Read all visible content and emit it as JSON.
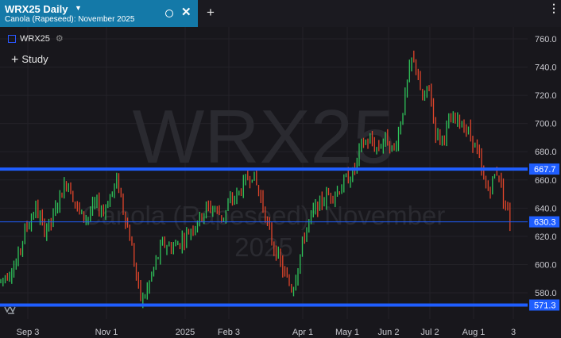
{
  "tab": {
    "title": "WRX25 Daily",
    "subtitle": "Canola (Rapeseed): November 2025",
    "caret_icon": "caret-down-icon",
    "circle_icon": "circle-icon",
    "close_icon": "close-icon"
  },
  "toolbar": {
    "new_tab": "+",
    "menu": "⋮"
  },
  "legend": {
    "symbol": "WRX25",
    "swatch_color": "#2a56ff"
  },
  "study": {
    "icon": "+",
    "label": "Study"
  },
  "watermark": {
    "symbol": "WRX25",
    "line1": "Canola (Rapeseed): November",
    "line2": "2025"
  },
  "chart_data": {
    "type": "candlestick",
    "y_axis": {
      "ticks": [
        580,
        600,
        620,
        640,
        660,
        680,
        700,
        720,
        740,
        760
      ],
      "range": [
        567,
        767
      ]
    },
    "x_axis": {
      "labels": [
        "Sep 3",
        "Nov 1",
        "2025",
        "Feb 3",
        "Apr 1",
        "May 1",
        "Jun 2",
        "Jul 2",
        "Aug 1",
        "3"
      ]
    },
    "horizontal_lines": [
      {
        "value": 667.7,
        "label": "667.7",
        "style": "thick",
        "color": "#1f5eff"
      },
      {
        "value": 630.3,
        "label": "630.3",
        "style": "thin",
        "color": "#1f5eff"
      },
      {
        "value": 571.3,
        "label": "571.3",
        "style": "thick",
        "color": "#1f5eff"
      }
    ],
    "up_color": "#2fc45a",
    "down_color": "#e0452b",
    "price_path": [
      [
        0,
        588
      ],
      [
        20,
        600
      ],
      [
        32,
        625
      ],
      [
        45,
        640
      ],
      [
        55,
        625
      ],
      [
        65,
        630
      ],
      [
        75,
        648
      ],
      [
        85,
        660
      ],
      [
        92,
        648
      ],
      [
        100,
        636
      ],
      [
        110,
        633
      ],
      [
        120,
        643
      ],
      [
        130,
        638
      ],
      [
        140,
        650
      ],
      [
        148,
        660
      ],
      [
        155,
        640
      ],
      [
        165,
        615
      ],
      [
        172,
        590
      ],
      [
        178,
        573
      ],
      [
        185,
        582
      ],
      [
        195,
        600
      ],
      [
        205,
        615
      ],
      [
        215,
        612
      ],
      [
        225,
        615
      ],
      [
        240,
        625
      ],
      [
        250,
        632
      ],
      [
        260,
        640
      ],
      [
        270,
        640
      ],
      [
        280,
        633
      ],
      [
        290,
        645
      ],
      [
        300,
        650
      ],
      [
        310,
        660
      ],
      [
        318,
        665
      ],
      [
        325,
        652
      ],
      [
        332,
        640
      ],
      [
        340,
        620
      ],
      [
        350,
        605
      ],
      [
        360,
        590
      ],
      [
        368,
        582
      ],
      [
        375,
        600
      ],
      [
        385,
        625
      ],
      [
        395,
        638
      ],
      [
        405,
        645
      ],
      [
        415,
        650
      ],
      [
        425,
        652
      ],
      [
        435,
        660
      ],
      [
        445,
        665
      ],
      [
        455,
        685
      ],
      [
        465,
        688
      ],
      [
        475,
        682
      ],
      [
        485,
        690
      ],
      [
        495,
        680
      ],
      [
        502,
        695
      ],
      [
        510,
        720
      ],
      [
        518,
        745
      ],
      [
        525,
        740
      ],
      [
        530,
        715
      ],
      [
        540,
        725
      ],
      [
        548,
        695
      ],
      [
        555,
        688
      ],
      [
        565,
        700
      ],
      [
        575,
        703
      ],
      [
        585,
        698
      ],
      [
        595,
        688
      ],
      [
        602,
        677
      ],
      [
        608,
        660
      ],
      [
        615,
        652
      ],
      [
        620,
        660
      ],
      [
        627,
        668
      ],
      [
        632,
        650
      ],
      [
        638,
        640
      ],
      [
        643,
        626
      ]
    ]
  }
}
